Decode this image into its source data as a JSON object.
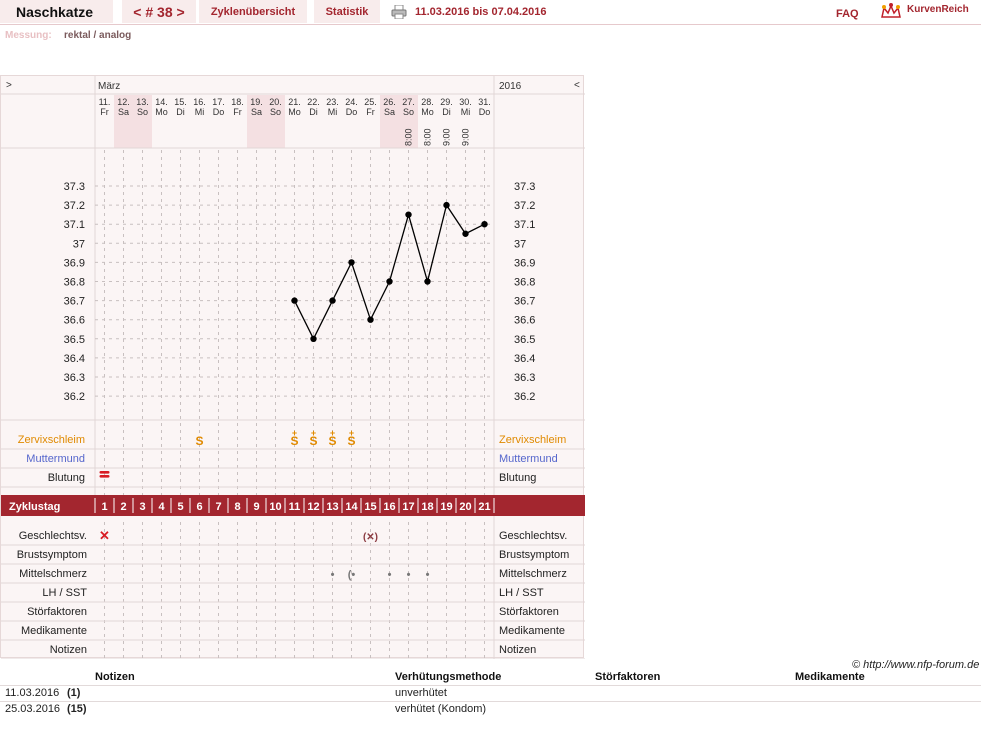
{
  "header": {
    "user_name": "Naschkatze",
    "cycle_nav": "< # 38 >",
    "tab_overview": "Zyklenübersicht",
    "tab_statistics": "Statistik",
    "date_range": "11.03.2016 bis 07.04.2016",
    "faq": "FAQ",
    "brand": "KurvenReich",
    "measure_label": "Messung:",
    "measure_value": "rektal / analog",
    "icons": {
      "print": "printer-icon",
      "brand": "crown-icon"
    },
    "colors": {
      "accent": "#a3262f",
      "weekend": "#f4e0e2",
      "curve": "#000000",
      "cervix": "#e08a00",
      "mucus": "#5566cc"
    }
  },
  "chart_data": {
    "type": "line",
    "title": "",
    "nav_left": ">",
    "nav_right": "<",
    "month_label": "März",
    "year_label": "2016",
    "x": [
      "11.",
      "12.",
      "13.",
      "14.",
      "15.",
      "16.",
      "17.",
      "18.",
      "19.",
      "20.",
      "21.",
      "22.",
      "23.",
      "24.",
      "25.",
      "26.",
      "27.",
      "28.",
      "29.",
      "30.",
      "31."
    ],
    "weekdays": [
      "Fr",
      "Sa",
      "So",
      "Mo",
      "Di",
      "Mi",
      "Do",
      "Fr",
      "Sa",
      "So",
      "Mo",
      "Di",
      "Mi",
      "Do",
      "Fr",
      "Sa",
      "So",
      "Mo",
      "Di",
      "Mi",
      "Do"
    ],
    "weekend_days": [
      1,
      2,
      8,
      9,
      15,
      16
    ],
    "times": [
      "",
      "",
      "",
      "",
      "",
      "",
      "",
      "",
      "",
      "",
      "",
      "",
      "",
      "",
      "",
      "",
      "8:00",
      "8:00",
      "9:00",
      "9:00",
      ""
    ],
    "cycle_days": [
      "1",
      "2",
      "3",
      "4",
      "5",
      "6",
      "7",
      "8",
      "9",
      "10",
      "11",
      "12",
      "13",
      "14",
      "15",
      "16",
      "17",
      "18",
      "19",
      "20",
      "21"
    ],
    "cycle_day_label": "Zyklustag",
    "ylim": [
      36.2,
      37.3
    ],
    "yticks": [
      "37.3",
      "37.2",
      "37.1",
      "37",
      "36.9",
      "36.8",
      "36.7",
      "36.6",
      "36.5",
      "36.4",
      "36.3",
      "36.2"
    ],
    "series": [
      {
        "values": [
          null,
          null,
          null,
          null,
          null,
          null,
          null,
          null,
          null,
          null,
          36.7,
          36.5,
          36.7,
          36.9,
          36.6,
          36.8,
          37.15,
          36.8,
          37.2,
          37.05,
          37.1
        ]
      }
    ],
    "cervix_row": {
      "label": "Zervixschleim",
      "symbols": [
        "",
        "",
        "",
        "",
        "",
        "S",
        "",
        "",
        "",
        "",
        "S",
        "S",
        "S",
        "S",
        "",
        "",
        "",
        "",
        "",
        "",
        ""
      ],
      "plus": [
        "",
        "",
        "",
        "",
        "",
        "",
        "",
        "",
        "",
        "",
        "+",
        "+",
        "+",
        "+",
        "",
        "",
        "",
        "",
        "",
        "",
        ""
      ]
    },
    "mouth_row": {
      "label": "Muttermund"
    },
    "bleeding_row": {
      "label": "Blutung",
      "marks": [
        2,
        0,
        0,
        0,
        0,
        0,
        0,
        0,
        0,
        0,
        0,
        0,
        0,
        0,
        0,
        0,
        0,
        0,
        0,
        0,
        0
      ]
    },
    "bottom_rows": [
      {
        "label": "Geschlechtsv.",
        "marks": [
          "x",
          "",
          "",
          "",
          "",
          "",
          "",
          "",
          "",
          "",
          "",
          "",
          "",
          "",
          "(x)",
          "",
          "",
          "",
          "",
          "",
          ""
        ]
      },
      {
        "label": "Brustsymptom",
        "marks": []
      },
      {
        "label": "Mittelschmerz",
        "marks": [
          "",
          "",
          "",
          "",
          "",
          "",
          "",
          "",
          "",
          "",
          "",
          "",
          "•",
          "(•",
          "",
          "•",
          "•",
          "•",
          "",
          "",
          ""
        ]
      },
      {
        "label": "LH / SST",
        "marks": []
      },
      {
        "label": "Störfaktoren",
        "marks": []
      },
      {
        "label": "Medikamente",
        "marks": []
      },
      {
        "label": "Notizen",
        "marks": []
      }
    ]
  },
  "footer": {
    "copyright": "© http://www.nfp-forum.de",
    "columns": [
      "Notizen",
      "Verhütungsmethode",
      "Störfaktoren",
      "Medikamente"
    ],
    "rows": [
      {
        "date": "11.03.2016",
        "day": "(1)",
        "method": "unverhütet"
      },
      {
        "date": "25.03.2016",
        "day": "(15)",
        "method": "verhütet (Kondom)"
      }
    ]
  }
}
